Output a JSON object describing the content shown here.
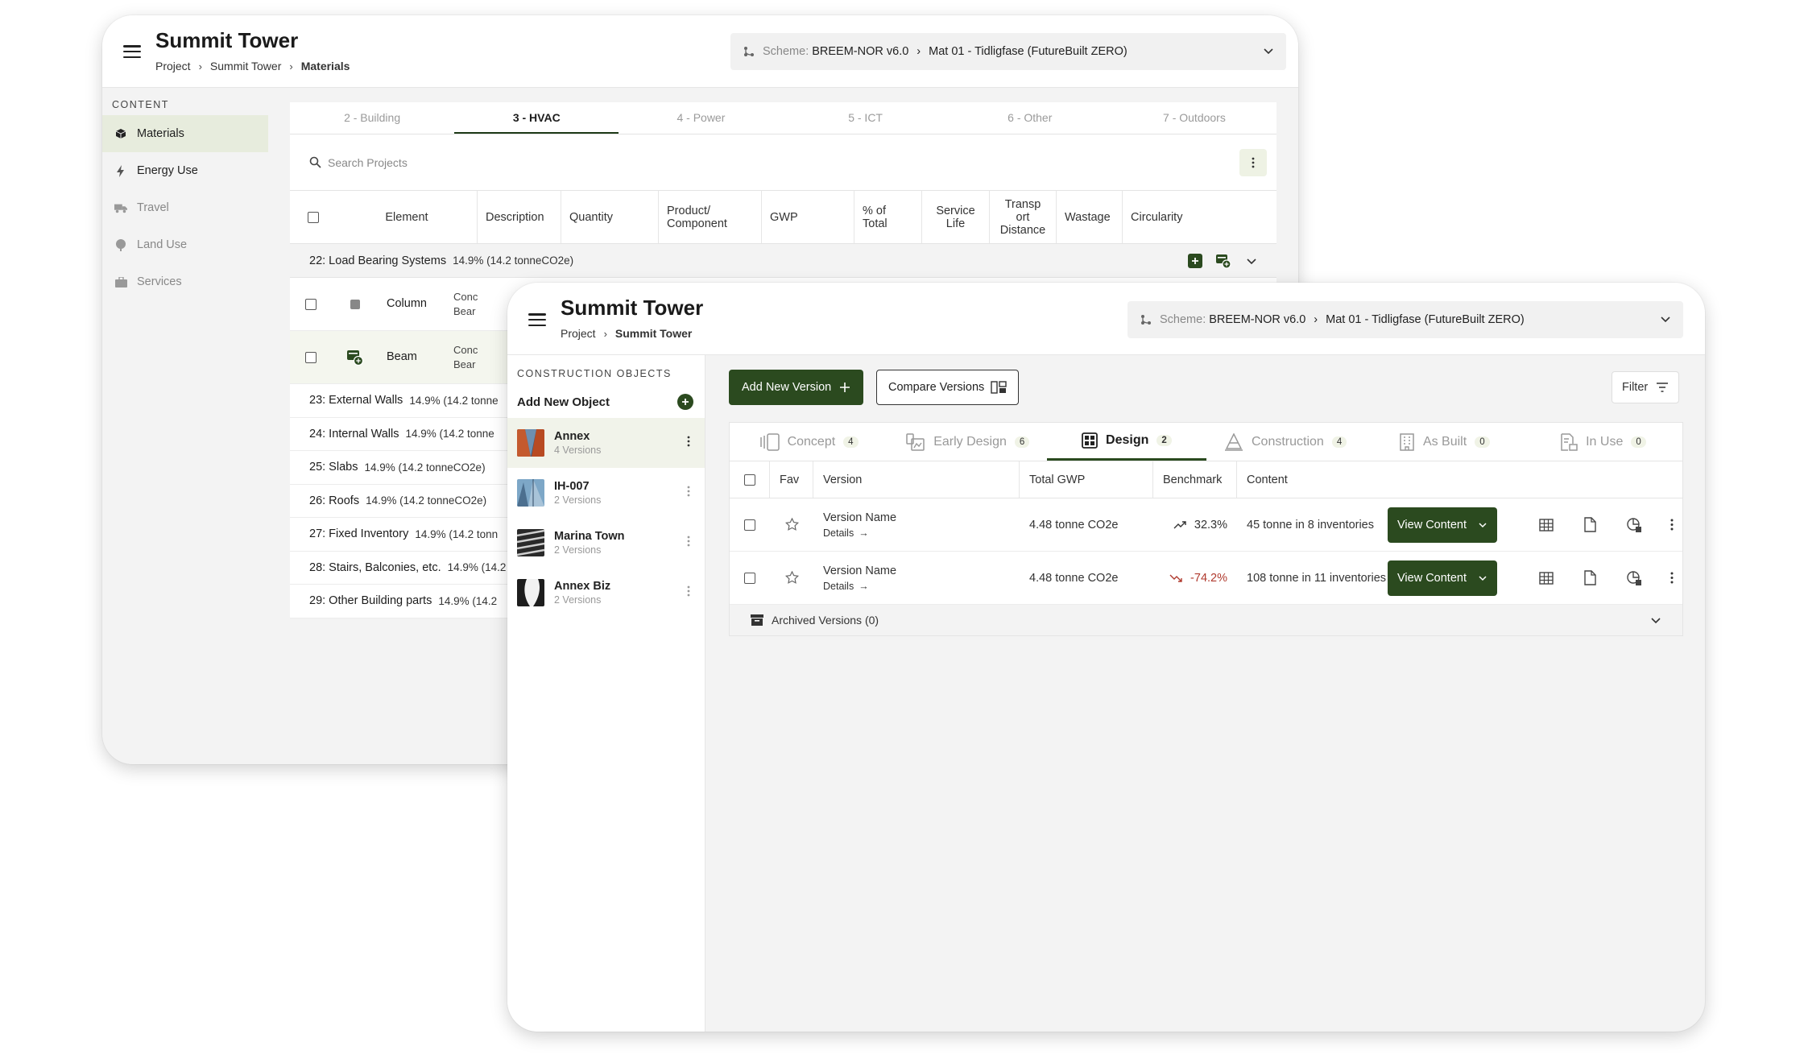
{
  "colors": {
    "accent": "#2b4a1f",
    "active_bg": "#e7ecdd",
    "negative": "#b03a2e"
  },
  "back": {
    "title": "Summit Tower",
    "breadcrumbs": [
      "Project",
      "Summit Tower",
      "Materials"
    ],
    "scheme_label": "Scheme:",
    "scheme_value": "BREEM-NOR v6.0",
    "scheme_target": "Mat 01 - Tidligfase (FutureBuilt ZERO)",
    "sidebar_heading": "CONTENT",
    "sidebar": [
      {
        "label": "Materials",
        "icon": "cube-icon",
        "active": true
      },
      {
        "label": "Energy Use",
        "icon": "bolt-icon"
      },
      {
        "label": "Travel",
        "icon": "truck-icon"
      },
      {
        "label": "Land Use",
        "icon": "tree-icon"
      },
      {
        "label": "Services",
        "icon": "briefcase-icon"
      }
    ],
    "tabs": [
      "2 - Building",
      "3 - HVAC",
      "4 - Power",
      "5 - ICT",
      "6 - Other",
      "7 - Outdoors"
    ],
    "search_placeholder": "Search Projects",
    "columns": [
      "Element",
      "Description",
      "Quantity",
      "Product/ Component",
      "GWP",
      "% of Total",
      "Service Life",
      "Transp ort Distance",
      "Wastage",
      "Circularity"
    ],
    "group": {
      "name": "22: Load Bearing Systems",
      "pct": "14.9% (14.2 tonneCO2e)"
    },
    "elements": [
      {
        "name": "Column",
        "desc": "Conc Bear"
      },
      {
        "name": "Beam",
        "desc": "Conc Bear"
      }
    ],
    "categories": [
      {
        "name": "23: External Walls",
        "pct": "14.9% (14.2 tonne"
      },
      {
        "name": "24: Internal Walls",
        "pct": "14.9% (14.2 tonne"
      },
      {
        "name": "25: Slabs",
        "pct": "14.9% (14.2 tonneCO2e)"
      },
      {
        "name": "26: Roofs",
        "pct": "14.9% (14.2 tonneCO2e)"
      },
      {
        "name": "27: Fixed Inventory",
        "pct": "14.9% (14.2 tonn"
      },
      {
        "name": "28: Stairs, Balconies, etc.",
        "pct": "14.9% (14.2"
      },
      {
        "name": "29: Other Building parts",
        "pct": "14.9% (14.2"
      }
    ]
  },
  "front": {
    "title": "Summit Tower",
    "breadcrumbs": [
      "Project",
      "Summit Tower"
    ],
    "scheme_label": "Scheme:",
    "scheme_value": "BREEM-NOR v6.0",
    "scheme_target": "Mat 01 - Tidligfase (FutureBuilt ZERO)",
    "objects_heading": "CONSTRUCTION OBJECTS",
    "add_object": "Add New Object",
    "objects": [
      {
        "name": "Annex",
        "versions": "4 Versions",
        "active": true
      },
      {
        "name": "IH-007",
        "versions": "2 Versions"
      },
      {
        "name": "Marina Town",
        "versions": "2 Versions"
      },
      {
        "name": "Annex Biz",
        "versions": "2 Versions"
      }
    ],
    "add_version": "Add New Version",
    "compare_versions": "Compare Versions",
    "filter": "Filter",
    "phases": [
      {
        "label": "Concept",
        "count": "4",
        "icon": "columns-icon"
      },
      {
        "label": "Early Design",
        "count": "6",
        "icon": "sketch-icon"
      },
      {
        "label": "Design",
        "count": "2",
        "icon": "grid-icon",
        "active": true
      },
      {
        "label": "Construction",
        "count": "4",
        "icon": "cone-icon"
      },
      {
        "label": "As Built",
        "count": "0",
        "icon": "building-icon"
      },
      {
        "label": "In Use",
        "count": "0",
        "icon": "doc-building-icon"
      }
    ],
    "columns": [
      "Fav",
      "Version",
      "Total GWP",
      "Benchmark",
      "Content"
    ],
    "versions": [
      {
        "name": "Version Name",
        "details": "Details",
        "gwp": "4.48 tonne CO2e",
        "benchmark": "32.3%",
        "trend": "up",
        "content": "45 tonne in 8 inventories",
        "action": "View Content"
      },
      {
        "name": "Version Name",
        "details": "Details",
        "gwp": "4.48 tonne CO2e",
        "benchmark": "-74.2%",
        "trend": "down",
        "content": "108 tonne in 11 inventories",
        "action": "View Content"
      }
    ],
    "archived": "Archived Versions (0)"
  }
}
